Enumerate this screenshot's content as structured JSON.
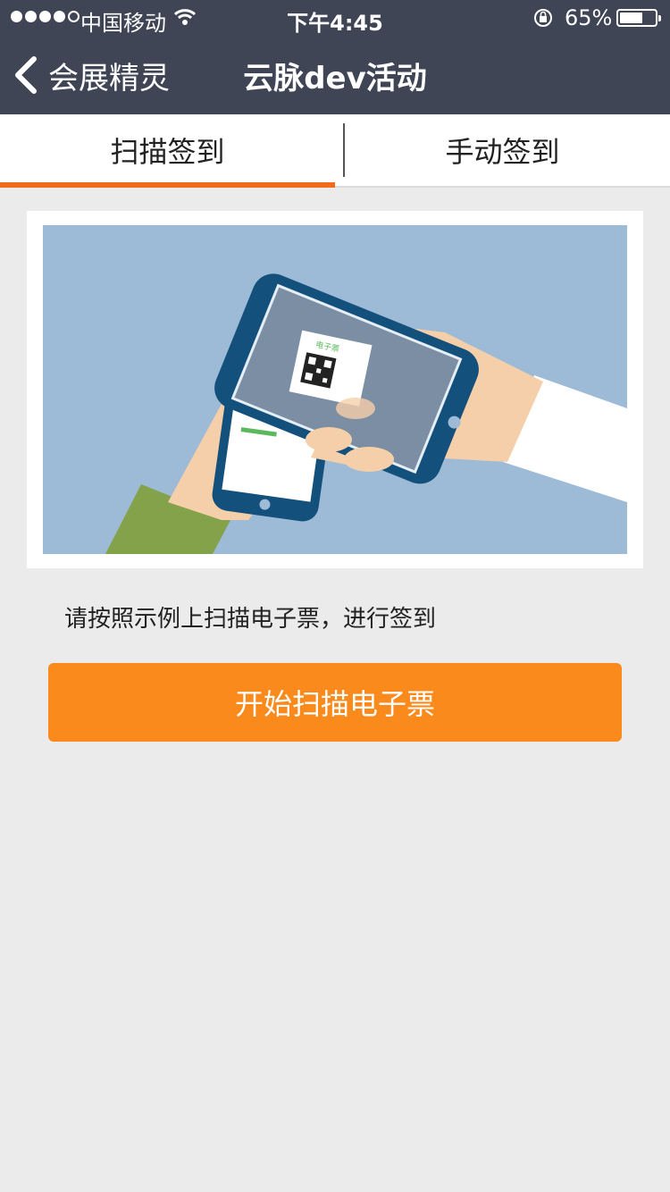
{
  "status_bar": {
    "carrier": "中国移动",
    "time": "下午4:45",
    "battery_percent": "65%",
    "battery_level": 0.65,
    "signal_icon": "signal-dots-icon",
    "wifi_icon": "wifi-icon",
    "rotation_lock_icon": "rotation-lock-icon"
  },
  "nav": {
    "back_label": "会展精灵",
    "back_icon": "chevron-left-icon",
    "title": "云脉dev活动"
  },
  "tabs": [
    {
      "label": "扫描签到",
      "active": true
    },
    {
      "label": "手动签到",
      "active": false
    }
  ],
  "illustration": {
    "name": "scan-ticket-illustration",
    "ticket_label": "电子票"
  },
  "hint_text": "请按照示例上扫描电子票，进行签到",
  "scan_button_label": "开始扫描电子票",
  "colors": {
    "nav_bg": "#3f4555",
    "accent_tab": "#f26a1b",
    "button": "#fb8a1c",
    "page_bg": "#ebebeb",
    "illustration_bg": "#9dbad6"
  }
}
